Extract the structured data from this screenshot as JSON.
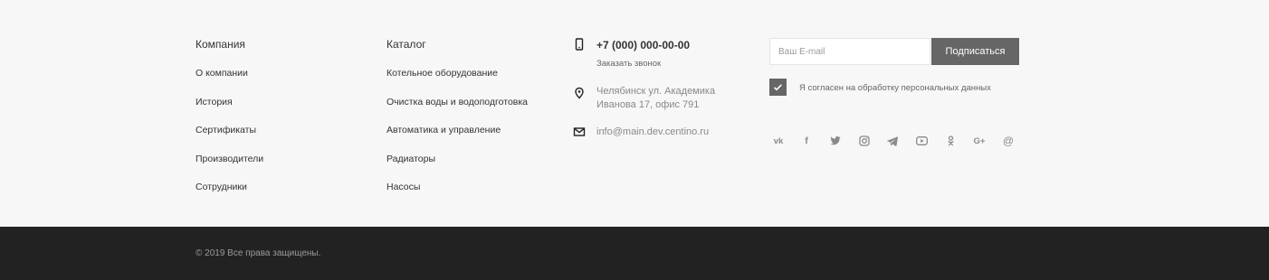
{
  "company": {
    "heading": "Компания",
    "links": [
      "О компании",
      "История",
      "Сертификаты",
      "Производители",
      "Сотрудники"
    ]
  },
  "catalog": {
    "heading": "Каталог",
    "links": [
      "Котельное оборудование",
      "Очистка воды и водоподготовка",
      "Автоматика и управление",
      "Радиаторы",
      "Насосы"
    ]
  },
  "contacts": {
    "phone": "+7 (000) 000-00-00",
    "callback": "Заказать звонок",
    "address_line1": "Челябинск ул. Академика",
    "address_line2": "Иванова 17, офис 791",
    "email": "info@main.dev.centino.ru",
    "icons": [
      "phone-icon",
      "location-pin-icon",
      "envelope-icon"
    ]
  },
  "subscribe": {
    "placeholder": "Ваш E-mail",
    "button_label": "Подписаться",
    "consent_label": "Я согласен на обработку персональных данных",
    "consent_checked": true
  },
  "socials": [
    {
      "name": "vk-icon",
      "glyph": "vk"
    },
    {
      "name": "facebook-icon",
      "glyph": "f"
    },
    {
      "name": "twitter-icon",
      "glyph": ""
    },
    {
      "name": "instagram-icon",
      "glyph": ""
    },
    {
      "name": "telegram-icon",
      "glyph": ""
    },
    {
      "name": "youtube-icon",
      "glyph": ""
    },
    {
      "name": "odnoklassniki-icon",
      "glyph": ""
    },
    {
      "name": "google-plus-icon",
      "glyph": "G+"
    },
    {
      "name": "email-at-icon",
      "glyph": "@"
    }
  ],
  "footer": {
    "copyright": "© 2019 Все права защищены."
  },
  "colors": {
    "background": "#f7f7f7",
    "footer_bottom": "#222222",
    "button": "#666666",
    "text": "#333333"
  }
}
